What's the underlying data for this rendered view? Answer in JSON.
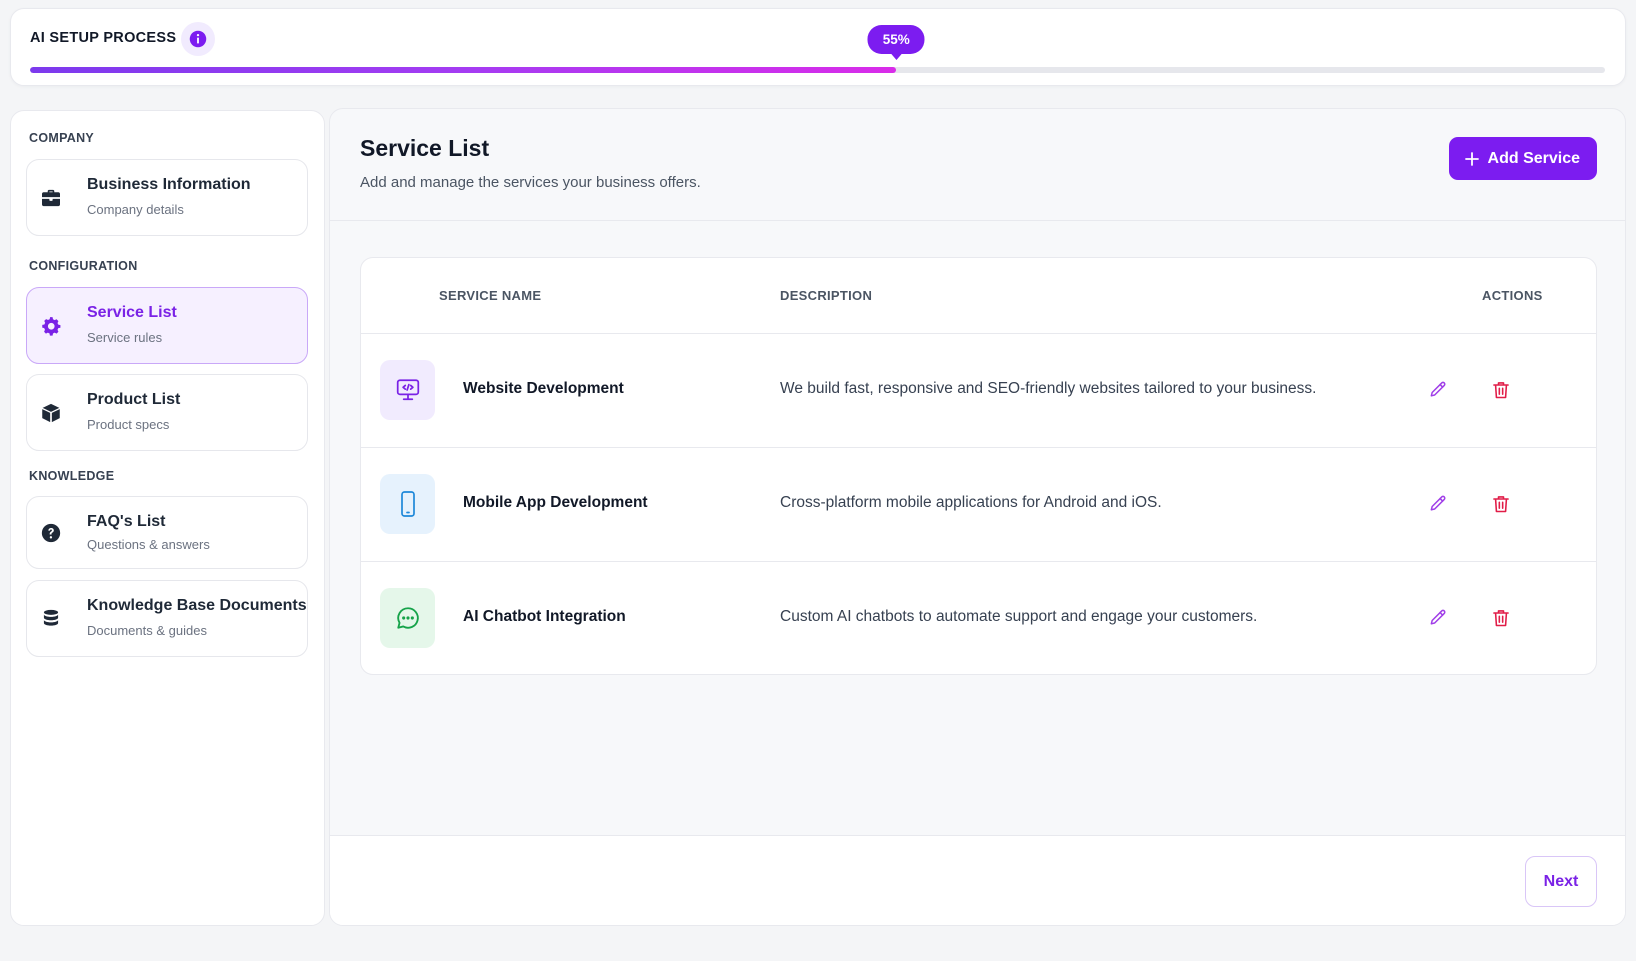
{
  "progress": {
    "title": "AI SETUP PROCESS",
    "percent": 55,
    "percent_label": "55%",
    "info_icon": "info-icon"
  },
  "sidebar": {
    "sections": [
      {
        "label": "COMPANY",
        "items": [
          {
            "title": "Business Information",
            "subtitle": "Company details",
            "icon": "briefcase-icon",
            "active": false
          }
        ]
      },
      {
        "label": "CONFIGURATION",
        "items": [
          {
            "title": "Service List",
            "subtitle": "Service rules",
            "icon": "gear-icon",
            "active": true
          },
          {
            "title": "Product List",
            "subtitle": "Product specs",
            "icon": "box-icon",
            "active": false
          }
        ]
      },
      {
        "label": "KNOWLEDGE",
        "items": [
          {
            "title": "FAQ's List",
            "subtitle": "Questions & answers",
            "icon": "question-circle-icon",
            "active": false
          },
          {
            "title": "Knowledge Base Documents",
            "subtitle": "Documents & guides",
            "icon": "database-icon",
            "active": false
          }
        ]
      }
    ]
  },
  "main": {
    "title": "Service List",
    "subtitle": "Add and manage the services your business offers.",
    "add_button": "Add Service",
    "next_button": "Next",
    "table": {
      "headers": {
        "name": "SERVICE NAME",
        "description": "DESCRIPTION",
        "actions": "ACTIONS"
      },
      "rows": [
        {
          "name": "Website Development",
          "description": "We build fast, responsive and SEO-friendly websites tailored to your business.",
          "icon": "monitor-code-icon"
        },
        {
          "name": "Mobile App Development",
          "description": "Cross-platform mobile applications for Android and iOS.",
          "icon": "smartphone-icon"
        },
        {
          "name": "AI Chatbot Integration",
          "description": "Custom AI chatbots to automate support and engage your customers.",
          "icon": "chat-bubble-icon"
        }
      ]
    }
  },
  "colors": {
    "accent": "#7c1cf0",
    "accent_text": "#7a22e6",
    "danger": "#e11d48",
    "website_icon_bg": "#f1ebfe",
    "mobile_icon_bg": "#e6f2fd",
    "chatbot_icon_bg": "#e5f7ea"
  }
}
